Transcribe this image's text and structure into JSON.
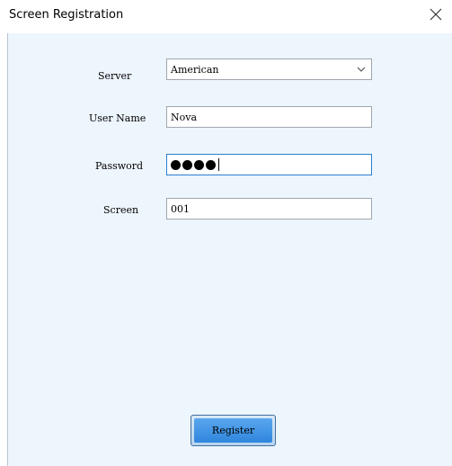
{
  "window": {
    "title": "Screen Registration",
    "close_icon": "close-icon"
  },
  "form": {
    "server": {
      "label": "Server",
      "value": "American",
      "icon": "chevron-down-icon"
    },
    "user_name": {
      "label": "User Name",
      "value": "Nova"
    },
    "password": {
      "label": "Password",
      "masked_length": 4
    },
    "screen": {
      "label": "Screen",
      "value": "001"
    }
  },
  "actions": {
    "register_label": "Register"
  },
  "colors": {
    "content_background": "#edf5fd",
    "focus_border": "#2a7fd1",
    "button_blue": "#3a8fe3"
  }
}
